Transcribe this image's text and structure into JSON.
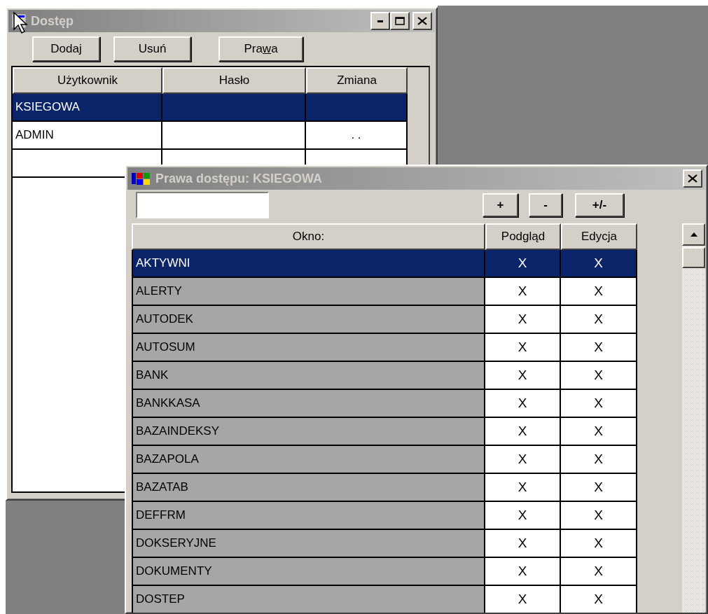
{
  "windows": [
    {
      "title": "Dostęp",
      "buttons": [
        {
          "label_parts": [
            "Dodaj"
          ]
        },
        {
          "label_parts": [
            "Usuń"
          ]
        },
        {
          "label_parts": [
            "Pra",
            "w",
            "a"
          ]
        }
      ],
      "columns": [
        "Użytkownik",
        "Hasło",
        "Zmiana"
      ],
      "rows": [
        {
          "cells": [
            "KSIEGOWA",
            "",
            ""
          ],
          "selected": true
        },
        {
          "cells": [
            "ADMIN",
            "",
            ". ."
          ],
          "selected": false
        }
      ]
    },
    {
      "title": "Prawa dostępu: KSIEGOWA",
      "buttons": [
        "+",
        "-",
        "+/-"
      ],
      "columns": [
        "Okno:",
        "Podgląd",
        "Edycja"
      ],
      "rows": [
        {
          "name": "AKTYWNI",
          "preview": "X",
          "edit": "X",
          "selected": true
        },
        {
          "name": "ALERTY",
          "preview": "X",
          "edit": "X",
          "selected": false
        },
        {
          "name": "AUTODEK",
          "preview": "X",
          "edit": "X",
          "selected": false
        },
        {
          "name": "AUTOSUM",
          "preview": "X",
          "edit": "X",
          "selected": false
        },
        {
          "name": "BANK",
          "preview": "X",
          "edit": "X",
          "selected": false
        },
        {
          "name": "BANKKASA",
          "preview": "X",
          "edit": "X",
          "selected": false
        },
        {
          "name": "BAZAINDEKSY",
          "preview": "X",
          "edit": "X",
          "selected": false
        },
        {
          "name": "BAZAPOLA",
          "preview": "X",
          "edit": "X",
          "selected": false
        },
        {
          "name": "BAZATAB",
          "preview": "X",
          "edit": "X",
          "selected": false
        },
        {
          "name": "DEFFRM",
          "preview": "X",
          "edit": "X",
          "selected": false
        },
        {
          "name": "DOKSERYJNE",
          "preview": "X",
          "edit": "X",
          "selected": false
        },
        {
          "name": "DOKUMENTY",
          "preview": "X",
          "edit": "X",
          "selected": false
        },
        {
          "name": "DOSTEP",
          "preview": "X",
          "edit": "X",
          "selected": false
        }
      ]
    }
  ]
}
